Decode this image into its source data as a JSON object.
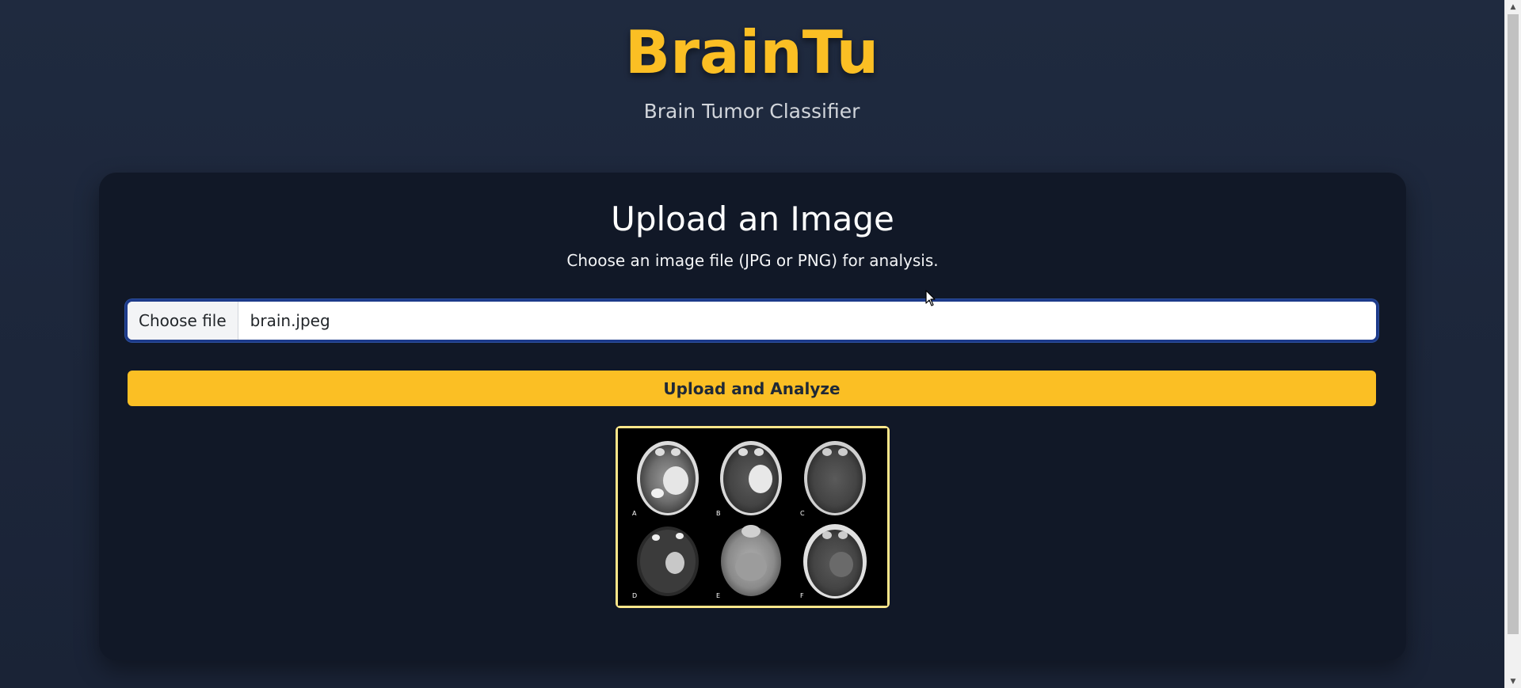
{
  "header": {
    "brand": "BrainTu",
    "tagline": "Brain Tumor Classifier"
  },
  "upload": {
    "title": "Upload an Image",
    "subtitle": "Choose an image file (JPG or PNG) for analysis.",
    "choose_file_label": "Choose file",
    "file_name": "brain.jpeg",
    "submit_label": "Upload and Analyze"
  },
  "preview": {
    "panel_labels": [
      "A",
      "B",
      "C",
      "D",
      "E",
      "F"
    ]
  },
  "colors": {
    "accent": "#fbbf24",
    "background": "#1e293b",
    "card": "#111827"
  }
}
